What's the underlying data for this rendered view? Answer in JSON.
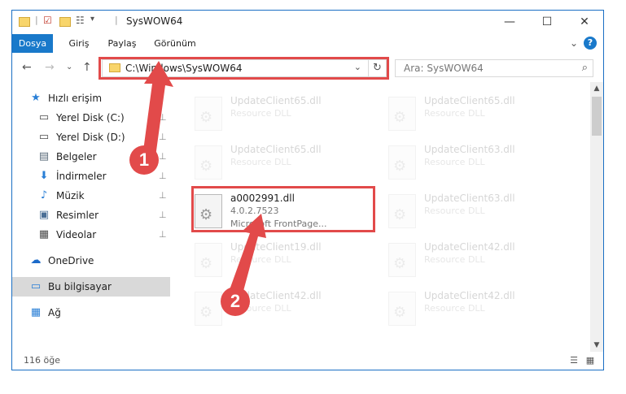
{
  "window": {
    "title": "SysWOW64"
  },
  "titlebar": {
    "minimize": "—",
    "maximize": "☐",
    "close": "✕"
  },
  "ribbon": {
    "tabs": [
      "Dosya",
      "Giriş",
      "Paylaş",
      "Görünüm"
    ],
    "collapse": "⌄",
    "help": "?"
  },
  "nav": {
    "back": "←",
    "forward": "→",
    "recent": "⌄",
    "up": "↑",
    "address": "C:\\Windows\\SysWOW64",
    "address_chevron": "⌄",
    "refresh": "↻",
    "search_placeholder": "Ara: SysWOW64",
    "search_icon": "⌕"
  },
  "sidebar": {
    "items": [
      {
        "label": "Hızlı erişim",
        "icon": "star-icon",
        "glyph": "★",
        "color": "#2a7fd6",
        "pinned": false
      },
      {
        "label": "Yerel Disk (C:)",
        "icon": "drive-icon",
        "glyph": "▭",
        "color": "#4a4a4a",
        "pinned": true
      },
      {
        "label": "Yerel Disk (D:)",
        "icon": "drive-icon",
        "glyph": "▭",
        "color": "#4a4a4a",
        "pinned": true
      },
      {
        "label": "Belgeler",
        "icon": "document-icon",
        "glyph": "▤",
        "color": "#5a6b7a",
        "pinned": true
      },
      {
        "label": "İndirmeler",
        "icon": "download-icon",
        "glyph": "⬇",
        "color": "#2a7fd6",
        "pinned": true
      },
      {
        "label": "Müzik",
        "icon": "music-icon",
        "glyph": "♪",
        "color": "#2a7fd6",
        "pinned": true
      },
      {
        "label": "Resimler",
        "icon": "pictures-icon",
        "glyph": "▣",
        "color": "#4b6f96",
        "pinned": true
      },
      {
        "label": "Videolar",
        "icon": "video-icon",
        "glyph": "▦",
        "color": "#4a4a4a",
        "pinned": true
      },
      {
        "label": "OneDrive",
        "icon": "cloud-icon",
        "glyph": "☁",
        "color": "#1b6ac9",
        "pinned": false
      },
      {
        "label": "Bu bilgisayar",
        "icon": "computer-icon",
        "glyph": "▭",
        "color": "#2a7fd6",
        "pinned": false,
        "selected": true
      },
      {
        "label": "Ağ",
        "icon": "network-icon",
        "glyph": "▦",
        "color": "#2a7fd6",
        "pinned": false
      }
    ],
    "pin_glyph": "📌"
  },
  "files": {
    "left": [
      {
        "name": "UpdateClient65.dll",
        "meta1": "Resource DLL",
        "faded": true
      },
      {
        "name": "UpdateClient65.dll",
        "meta1": "Resource DLL",
        "faded": true
      },
      {
        "name": "a0002991.dll",
        "meta1": "4.0.2.7523",
        "meta2": "Microsoft FrontPage...",
        "faded": false
      },
      {
        "name": "UpdateClient19.dll",
        "meta1": "Resource DLL",
        "faded": true
      },
      {
        "name": "UpdateClient42.dll",
        "meta1": "Resource DLL",
        "faded": true
      }
    ],
    "right": [
      {
        "name": "UpdateClient65.dll",
        "meta1": "Resource DLL",
        "faded": true
      },
      {
        "name": "UpdateClient63.dll",
        "meta1": "Resource DLL",
        "faded": true
      },
      {
        "name": "UpdateClient63.dll",
        "meta1": "Resource DLL",
        "faded": true
      },
      {
        "name": "UpdateClient42.dll",
        "meta1": "Resource DLL",
        "faded": true
      },
      {
        "name": "UpdateClient42.dll",
        "meta1": "Resource DLL",
        "faded": true
      }
    ]
  },
  "annotations": {
    "step1": "1",
    "step2": "2",
    "color": "#e24a4a"
  },
  "status": {
    "count": "116 öğe",
    "details_view": "☰",
    "tiles_view": "▦"
  }
}
